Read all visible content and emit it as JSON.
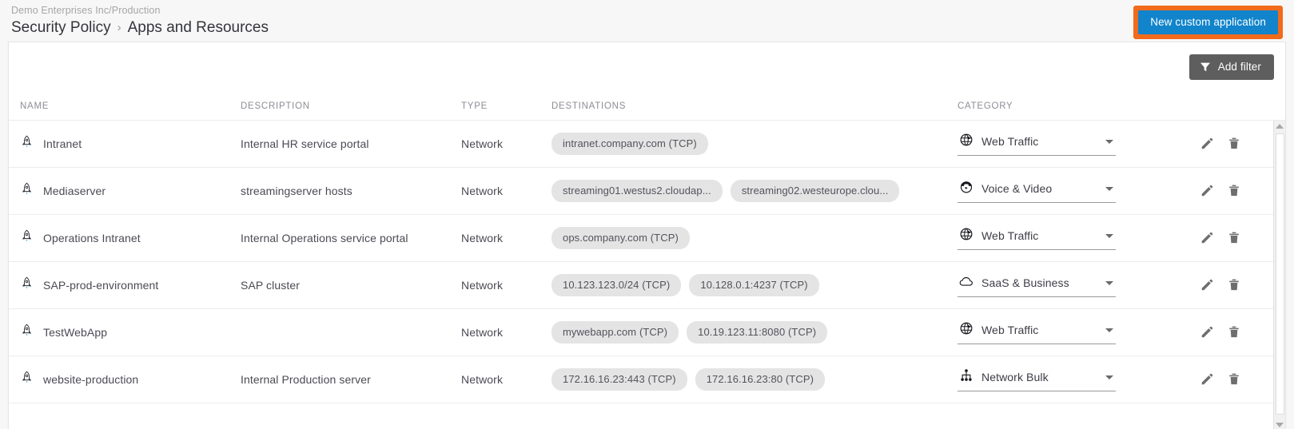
{
  "header": {
    "org_breadcrumb": "Demo Enterprises Inc/Production",
    "section": "Security Policy",
    "separator": "›",
    "current_page": "Apps and Resources",
    "new_app_button": "New custom application",
    "new_app_button_color": "#1184cb",
    "new_app_highlight_color": "#f26a1b"
  },
  "toolbar": {
    "add_filter_label": "Add filter",
    "add_filter_color": "#5e5e5e"
  },
  "table": {
    "columns": [
      {
        "key": "name",
        "label": "NAME"
      },
      {
        "key": "description",
        "label": "DESCRIPTION"
      },
      {
        "key": "type",
        "label": "TYPE"
      },
      {
        "key": "destinations",
        "label": "DESTINATIONS"
      },
      {
        "key": "category",
        "label": "CATEGORY"
      }
    ],
    "row_icon": "rocket-icon",
    "actions": [
      {
        "name": "edit-icon",
        "label": "Edit"
      },
      {
        "name": "delete-icon",
        "label": "Delete"
      }
    ],
    "rows": [
      {
        "name": "Intranet",
        "description": "Internal HR service portal",
        "type": "Network",
        "destinations": [
          "intranet.company.com (TCP)"
        ],
        "category": "Web Traffic",
        "category_icon": "globe-icon"
      },
      {
        "name": "Mediaserver",
        "description": "streamingserver hosts",
        "type": "Network",
        "destinations": [
          "streaming01.westus2.cloudap...",
          "streaming02.westeurope.clou..."
        ],
        "category": "Voice & Video",
        "category_icon": "phone-icon"
      },
      {
        "name": "Operations Intranet",
        "description": "Internal Operations service portal",
        "type": "Network",
        "destinations": [
          "ops.company.com (TCP)"
        ],
        "category": "Web Traffic",
        "category_icon": "globe-icon"
      },
      {
        "name": "SAP-prod-environment",
        "description": "SAP cluster",
        "type": "Network",
        "destinations": [
          "10.123.123.0/24 (TCP)",
          "10.128.0.1:4237 (TCP)"
        ],
        "category": "SaaS & Business",
        "category_icon": "cloud-icon"
      },
      {
        "name": "TestWebApp",
        "description": "",
        "type": "Network",
        "destinations": [
          "mywebapp.com (TCP)",
          "10.19.123.11:8080 (TCP)"
        ],
        "category": "Web Traffic",
        "category_icon": "globe-icon"
      },
      {
        "name": "website-production",
        "description": "Internal Production server",
        "type": "Network",
        "destinations": [
          "172.16.16.23:443 (TCP)",
          "172.16.16.23:80 (TCP)"
        ],
        "category": "Network Bulk",
        "category_icon": "sitemap-icon"
      }
    ]
  }
}
